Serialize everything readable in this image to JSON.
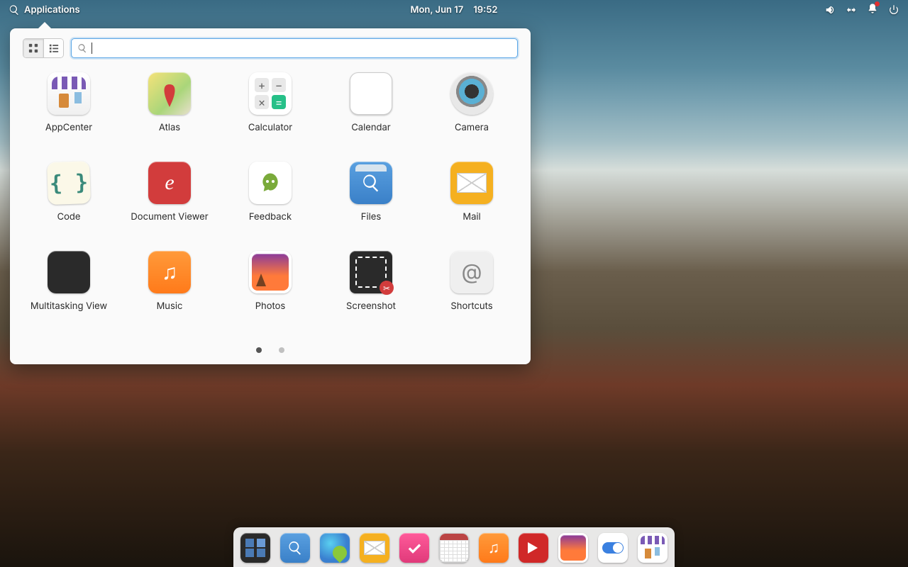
{
  "panel": {
    "applications_label": "Applications",
    "date": "Mon, Jun 17",
    "time": "19:52"
  },
  "launcher": {
    "search_value": "",
    "apps": [
      {
        "label": "AppCenter"
      },
      {
        "label": "Atlas"
      },
      {
        "label": "Calculator"
      },
      {
        "label": "Calendar"
      },
      {
        "label": "Camera"
      },
      {
        "label": "Code"
      },
      {
        "label": "Document Viewer"
      },
      {
        "label": "Feedback"
      },
      {
        "label": "Files"
      },
      {
        "label": "Mail"
      },
      {
        "label": "Multitasking View"
      },
      {
        "label": "Music"
      },
      {
        "label": "Photos"
      },
      {
        "label": "Screenshot"
      },
      {
        "label": "Shortcuts"
      }
    ],
    "pages": 2,
    "current_page": 1
  },
  "dock": {
    "items": [
      {
        "name": "multitasking"
      },
      {
        "name": "search"
      },
      {
        "name": "web"
      },
      {
        "name": "mail"
      },
      {
        "name": "tasks"
      },
      {
        "name": "calendar"
      },
      {
        "name": "music"
      },
      {
        "name": "videos"
      },
      {
        "name": "photos"
      },
      {
        "name": "settings"
      },
      {
        "name": "appcenter"
      }
    ]
  }
}
